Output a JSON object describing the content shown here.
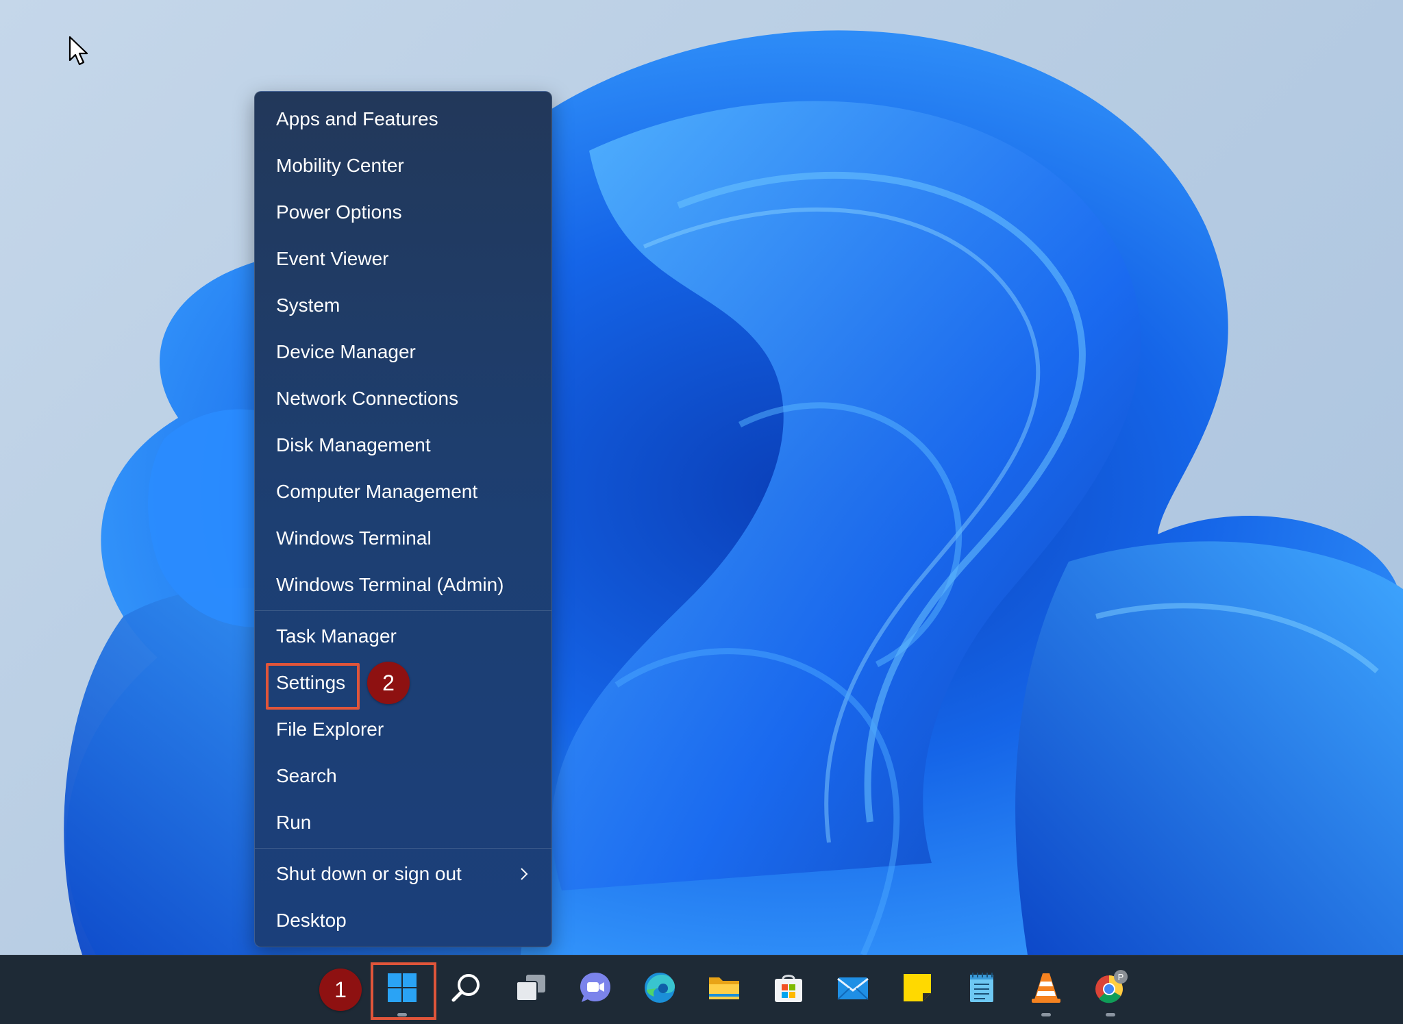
{
  "menu": {
    "items": [
      {
        "label": "Apps and Features"
      },
      {
        "label": "Mobility Center"
      },
      {
        "label": "Power Options"
      },
      {
        "label": "Event Viewer"
      },
      {
        "label": "System"
      },
      {
        "label": "Device Manager"
      },
      {
        "label": "Network Connections"
      },
      {
        "label": "Disk Management"
      },
      {
        "label": "Computer Management"
      },
      {
        "label": "Windows Terminal"
      },
      {
        "label": "Windows Terminal (Admin)"
      },
      {
        "label": "Task Manager"
      },
      {
        "label": "Settings"
      },
      {
        "label": "File Explorer"
      },
      {
        "label": "Search"
      },
      {
        "label": "Run"
      },
      {
        "label": "Shut down or sign out"
      },
      {
        "label": "Desktop"
      }
    ]
  },
  "annotations": {
    "step1": "1",
    "step2": "2",
    "highlight_color": "#e0553a",
    "badge_color": "#8e1111"
  },
  "taskbar": {
    "icons": [
      {
        "name": "start-icon"
      },
      {
        "name": "search-icon"
      },
      {
        "name": "task-view-icon"
      },
      {
        "name": "teams-chat-icon"
      },
      {
        "name": "edge-icon"
      },
      {
        "name": "file-explorer-icon"
      },
      {
        "name": "microsoft-store-icon"
      },
      {
        "name": "mail-icon"
      },
      {
        "name": "sticky-notes-icon"
      },
      {
        "name": "notepad-icon"
      },
      {
        "name": "vlc-icon"
      },
      {
        "name": "chrome-icon",
        "badge": "P"
      }
    ]
  },
  "theme": {
    "menu_bg": "#1d3f72",
    "taskbar_bg": "#1e2a36",
    "accent": "#0a6cff"
  }
}
